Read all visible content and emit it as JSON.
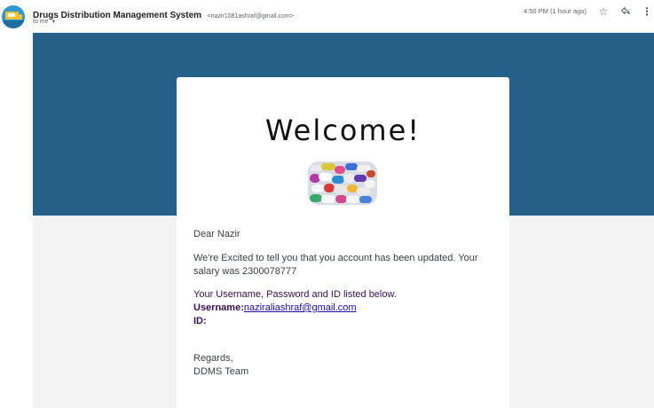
{
  "header": {
    "sender_name": "Drugs Distribution Management System",
    "sender_email": "<nazir1081ashraf@gmail.com>",
    "recipient": "to me",
    "timestamp": "4:50 PM (1 hour ago)",
    "icons": [
      "star-icon",
      "reply-icon",
      "more-vert-icon"
    ]
  },
  "email": {
    "title": "Welcome!",
    "greeting": "Dear Nazir",
    "message": "We're Excited to tell you that you account has been updated. Your salary was 2300078777",
    "listed_text": "Your Username, Password and ID listed below.",
    "username_label": "Username:",
    "username_value": "naziraliashraf@gmail.com",
    "id_label": "ID:",
    "regards": "Regards,",
    "team": "DDMS Team"
  },
  "colors": {
    "banner": "#256088",
    "background": "#f3f3f3",
    "accent_text": "#3b0e4f",
    "link": "#1a0dab"
  }
}
